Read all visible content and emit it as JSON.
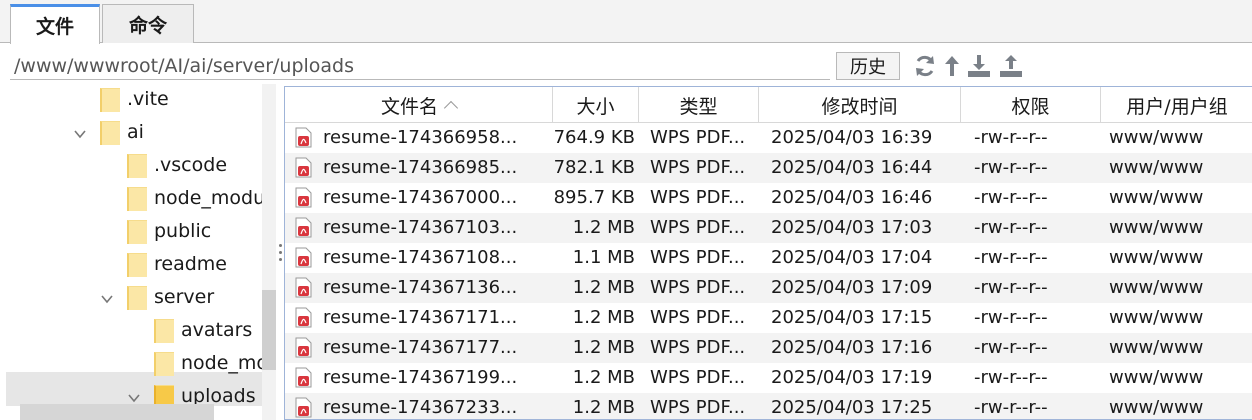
{
  "tabs": [
    {
      "label": "文件",
      "active": true
    },
    {
      "label": "命令",
      "active": false
    }
  ],
  "path": {
    "value": "/www/wwwroot/AI/ai/server/uploads"
  },
  "toolbar": {
    "history_label": "历史",
    "icons": [
      "refresh-icon",
      "up-arrow-icon",
      "download-icon",
      "upload-icon"
    ]
  },
  "tree": {
    "items": [
      {
        "label": ".vite",
        "level": 0,
        "expand": "none",
        "open": false
      },
      {
        "label": "ai",
        "level": 0,
        "expand": "expanded",
        "open": false
      },
      {
        "label": ".vscode",
        "level": 1,
        "expand": "none",
        "open": false
      },
      {
        "label": "node_modu",
        "level": 1,
        "expand": "none",
        "open": false
      },
      {
        "label": "public",
        "level": 1,
        "expand": "none",
        "open": false
      },
      {
        "label": "readme",
        "level": 1,
        "expand": "none",
        "open": false
      },
      {
        "label": "server",
        "level": 1,
        "expand": "expanded",
        "open": false
      },
      {
        "label": "avatars",
        "level": 2,
        "expand": "none",
        "open": false
      },
      {
        "label": "node_mo",
        "level": 2,
        "expand": "none",
        "open": false
      },
      {
        "label": "uploads",
        "level": 2,
        "expand": "expanded",
        "open": true,
        "selected": true
      }
    ]
  },
  "table": {
    "columns": [
      "文件名",
      "大小",
      "类型",
      "修改时间",
      "权限",
      "用户/用户组"
    ],
    "sort_column": "文件名",
    "rows": [
      {
        "name": "resume-174366958...",
        "size": "764.9 KB",
        "type": "WPS PDF...",
        "modified": "2025/04/03 16:39",
        "perm": "-rw-r--r--",
        "owner": "www/www"
      },
      {
        "name": "resume-174366985...",
        "size": "782.1 KB",
        "type": "WPS PDF...",
        "modified": "2025/04/03 16:44",
        "perm": "-rw-r--r--",
        "owner": "www/www"
      },
      {
        "name": "resume-174367000...",
        "size": "895.7 KB",
        "type": "WPS PDF...",
        "modified": "2025/04/03 16:46",
        "perm": "-rw-r--r--",
        "owner": "www/www"
      },
      {
        "name": "resume-174367103...",
        "size": "1.2 MB",
        "type": "WPS PDF...",
        "modified": "2025/04/03 17:03",
        "perm": "-rw-r--r--",
        "owner": "www/www"
      },
      {
        "name": "resume-174367108...",
        "size": "1.1 MB",
        "type": "WPS PDF...",
        "modified": "2025/04/03 17:04",
        "perm": "-rw-r--r--",
        "owner": "www/www"
      },
      {
        "name": "resume-174367136...",
        "size": "1.2 MB",
        "type": "WPS PDF...",
        "modified": "2025/04/03 17:09",
        "perm": "-rw-r--r--",
        "owner": "www/www"
      },
      {
        "name": "resume-174367171...",
        "size": "1.2 MB",
        "type": "WPS PDF...",
        "modified": "2025/04/03 17:15",
        "perm": "-rw-r--r--",
        "owner": "www/www"
      },
      {
        "name": "resume-174367177...",
        "size": "1.2 MB",
        "type": "WPS PDF...",
        "modified": "2025/04/03 17:16",
        "perm": "-rw-r--r--",
        "owner": "www/www"
      },
      {
        "name": "resume-174367199...",
        "size": "1.2 MB",
        "type": "WPS PDF...",
        "modified": "2025/04/03 17:19",
        "perm": "-rw-r--r--",
        "owner": "www/www"
      },
      {
        "name": "resume-174367233...",
        "size": "1.2 MB",
        "type": "WPS PDF...",
        "modified": "2025/04/03 17:25",
        "perm": "-rw-r--r--",
        "owner": "www/www"
      }
    ]
  },
  "colors": {
    "accent": "#4a8fe7",
    "pdf_icon": "#d9363e",
    "folder": "#f7c948"
  }
}
